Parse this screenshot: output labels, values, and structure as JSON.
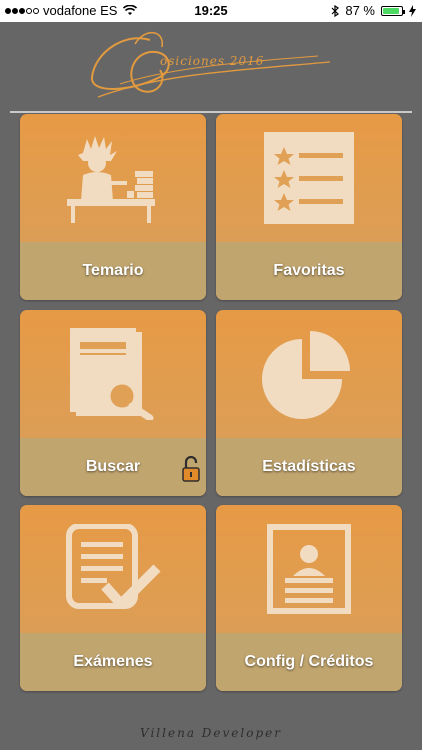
{
  "status_bar": {
    "carrier": "vodafone ES",
    "time": "19:25",
    "battery": "87 %",
    "battery_level": 0.87
  },
  "header": {
    "logo_script": "osiciones 2016"
  },
  "menu": {
    "temario": "Temario",
    "favoritas": "Favoritas",
    "buscar": "Buscar",
    "estadisticas": "Estadísticas",
    "examenes": "Exámenes",
    "config": "Config / Créditos"
  },
  "footer": {
    "signature": "Villena Developer"
  },
  "colors": {
    "background": "#666666",
    "tile_top": "#e79a45",
    "tile_band": "#c1a56f",
    "icon": "#f1dcc2",
    "logo": "#e29a3f"
  },
  "icons": {
    "temario": "student-at-desk-icon",
    "favoritas": "star-list-icon",
    "buscar": "document-search-icon",
    "estadisticas": "pie-chart-icon",
    "examenes": "exam-check-icon",
    "config": "id-card-icon",
    "lock": "unlocked-padlock-icon"
  }
}
